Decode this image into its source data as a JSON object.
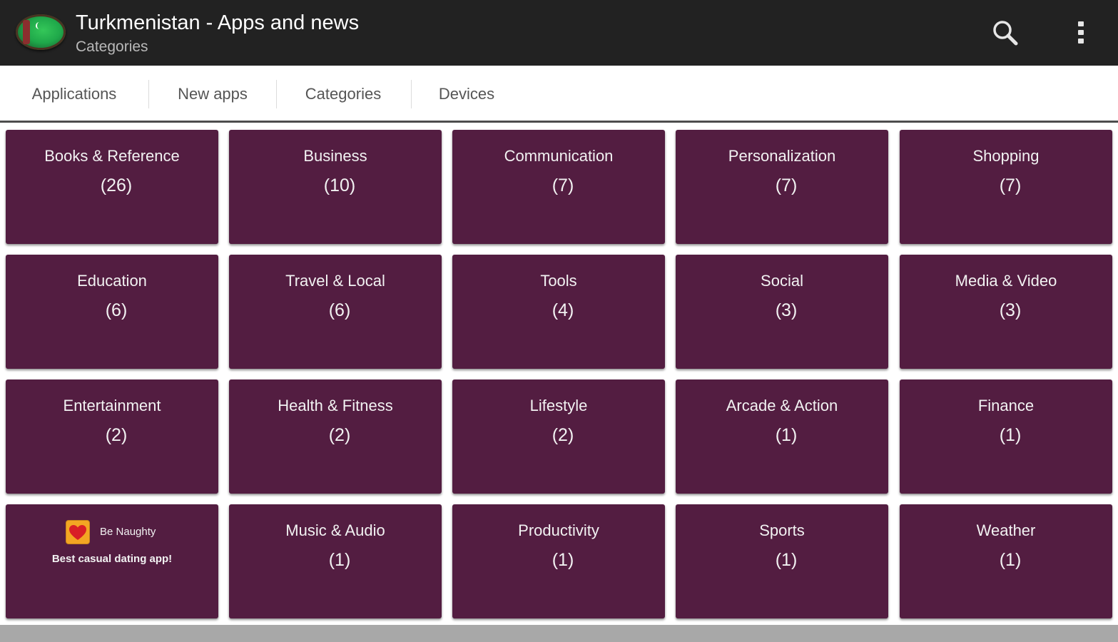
{
  "header": {
    "title": "Turkmenistan - Apps and news",
    "subtitle": "Categories",
    "logo_icon": "turkmenistan-flag-logo",
    "search_icon": "search-icon",
    "overflow_icon": "more-vert-icon"
  },
  "tabs": [
    {
      "label": "Applications"
    },
    {
      "label": "New apps"
    },
    {
      "label": "Categories"
    },
    {
      "label": "Devices"
    }
  ],
  "categories": [
    {
      "name": "Books & Reference",
      "count": "(26)"
    },
    {
      "name": "Business",
      "count": "(10)"
    },
    {
      "name": "Communication",
      "count": "(7)"
    },
    {
      "name": "Personalization",
      "count": "(7)"
    },
    {
      "name": "Shopping",
      "count": "(7)"
    },
    {
      "name": "Education",
      "count": "(6)"
    },
    {
      "name": "Travel & Local",
      "count": "(6)"
    },
    {
      "name": "Tools",
      "count": "(4)"
    },
    {
      "name": "Social",
      "count": "(3)"
    },
    {
      "name": "Media & Video",
      "count": "(3)"
    },
    {
      "name": "Entertainment",
      "count": "(2)"
    },
    {
      "name": "Health & Fitness",
      "count": "(2)"
    },
    {
      "name": "Lifestyle",
      "count": "(2)"
    },
    {
      "name": "Arcade & Action",
      "count": "(1)"
    },
    {
      "name": "Finance",
      "count": "(1)"
    },
    {
      "ad": true,
      "brand": "Be Naughty",
      "tagline": "Best casual dating app!",
      "icon": "heart-icon"
    },
    {
      "name": "Music & Audio",
      "count": "(1)"
    },
    {
      "name": "Productivity",
      "count": "(1)"
    },
    {
      "name": "Sports",
      "count": "(1)"
    },
    {
      "name": "Weather",
      "count": "(1)"
    }
  ],
  "colors": {
    "action_bar": "#222222",
    "tile": "#531d41",
    "tab_text": "#555555",
    "tab_underline": "#4d4d4d",
    "ad_icon_bg": "#f3a623",
    "heart": "#d81f26"
  }
}
